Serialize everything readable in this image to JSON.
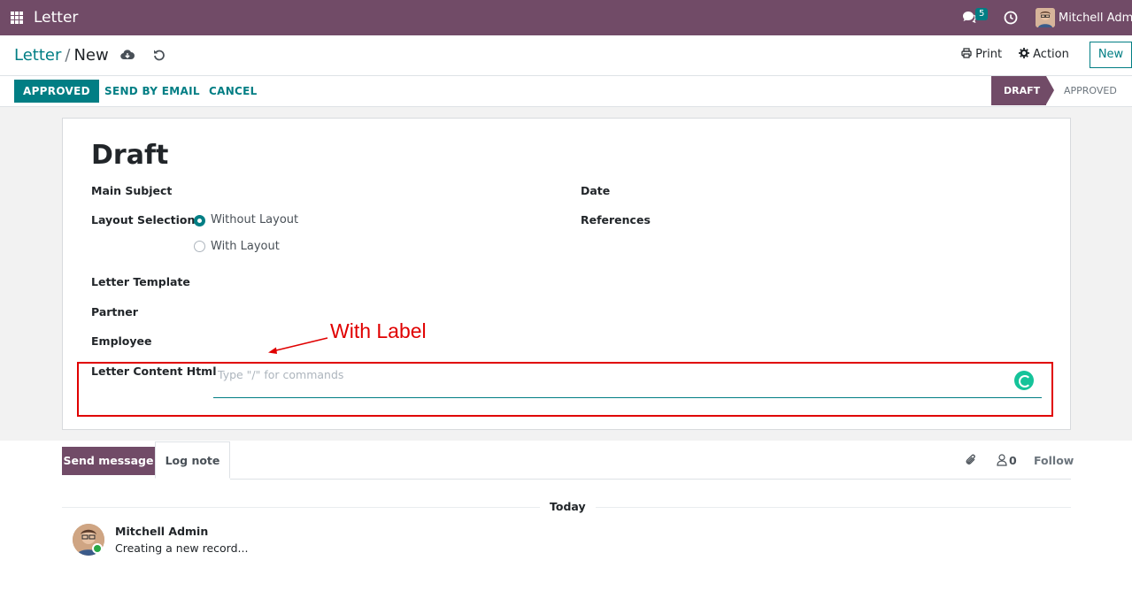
{
  "navbar": {
    "app_title": "Letter",
    "message_count": "5",
    "user_name": "Mitchell Admin"
  },
  "breadcrumb": {
    "parent": "Letter",
    "separator": "/",
    "current": "New"
  },
  "control": {
    "print_label": "Print",
    "action_label": "Action",
    "new_label": "New"
  },
  "statusbar": {
    "buttons": [
      "APPROVED",
      "SEND BY EMAIL",
      "CANCEL"
    ],
    "stages": [
      {
        "label": "DRAFT",
        "active": true
      },
      {
        "label": "APPROVED",
        "active": false
      }
    ]
  },
  "form": {
    "title": "Draft",
    "main_subject_label": "Main Subject",
    "layout_selection_label": "Layout Selection",
    "layout_options": [
      {
        "label": "Without Layout",
        "checked": true
      },
      {
        "label": "With Layout",
        "checked": false
      }
    ],
    "letter_template_label": "Letter Template",
    "partner_label": "Partner",
    "employee_label": "Employee",
    "content_html_label": "Letter Content Html",
    "content_html_placeholder": "Type \"/\" for commands",
    "date_label": "Date",
    "references_label": "References"
  },
  "annotation": {
    "text": "With Label",
    "color": "#e00000"
  },
  "chatter": {
    "send_message_label": "Send message",
    "log_note_label": "Log note",
    "follower_count": "0",
    "follow_label": "Follow",
    "date_separator": "Today",
    "messages": [
      {
        "author": "Mitchell Admin",
        "body": "Creating a new record..."
      }
    ]
  },
  "colors": {
    "brand": "#714b67",
    "accent": "#017e84"
  }
}
